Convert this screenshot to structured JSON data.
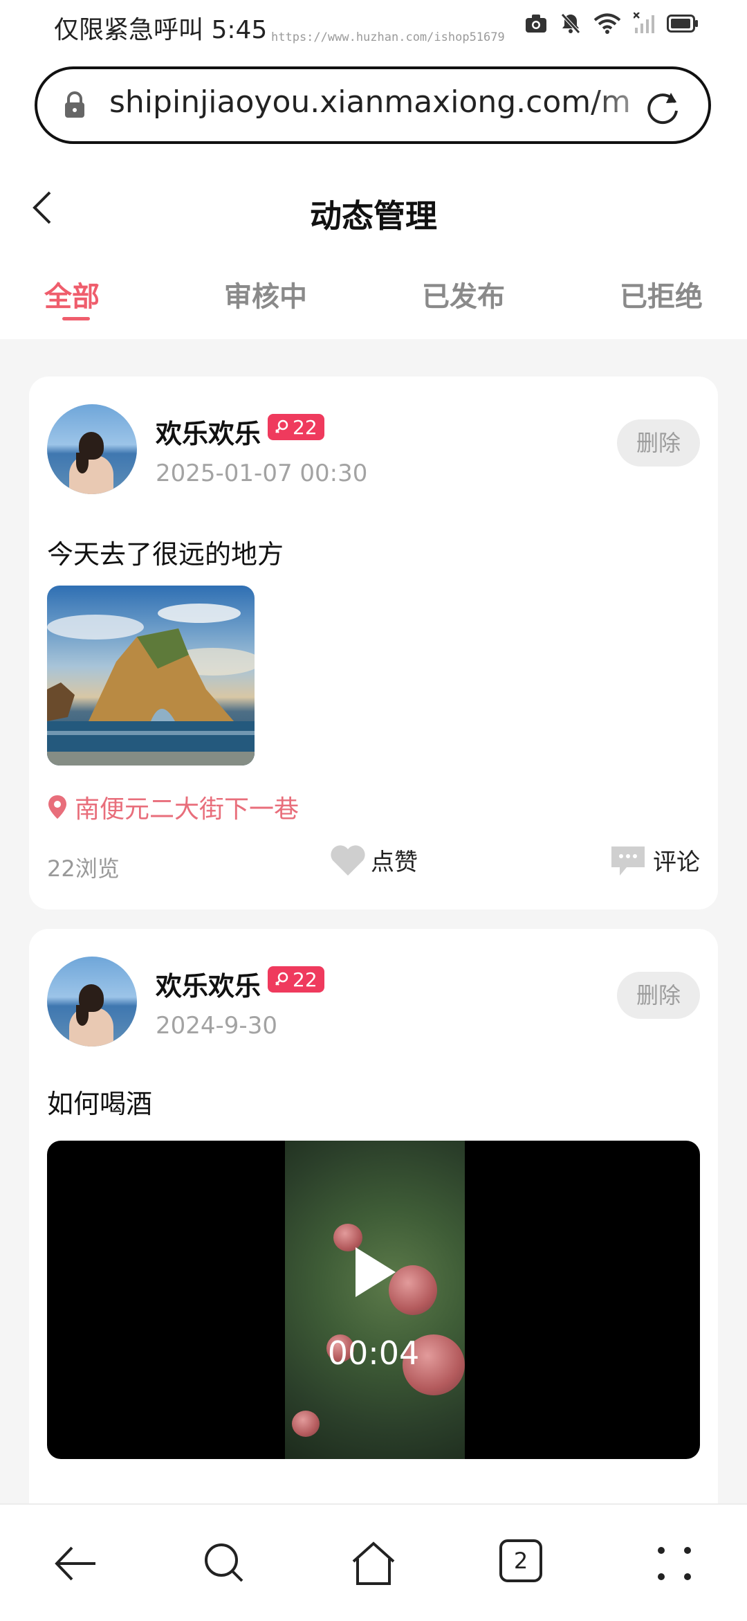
{
  "status_bar": {
    "left_text": "仅限紧急呼叫 5:45",
    "watermark": "https://www.huzhan.com/ishop51679"
  },
  "browser": {
    "url": "shipinjiaoyou.xianmaxiong.com/m"
  },
  "header": {
    "title": "动态管理"
  },
  "tabs": [
    {
      "label": "全部",
      "active": true
    },
    {
      "label": "审核中",
      "active": false
    },
    {
      "label": "已发布",
      "active": false
    },
    {
      "label": "已拒绝",
      "active": false
    }
  ],
  "posts": [
    {
      "username": "欢乐欢乐",
      "badge_age": "22",
      "time": "2025-01-07 00:30",
      "delete_label": "删除",
      "text": "今天去了很远的地方",
      "location": "南便元二大街下一巷",
      "views": "22浏览",
      "like_label": "点赞",
      "comment_label": "评论"
    },
    {
      "username": "欢乐欢乐",
      "badge_age": "22",
      "time": "2024-9-30",
      "delete_label": "删除",
      "text": "如何喝酒",
      "video_duration": "00:04"
    }
  ],
  "bottom_nav": {
    "tab_count": "2"
  },
  "colors": {
    "accent": "#ef5d6c",
    "badge": "#ef3a5d",
    "location": "#e86e7b"
  }
}
